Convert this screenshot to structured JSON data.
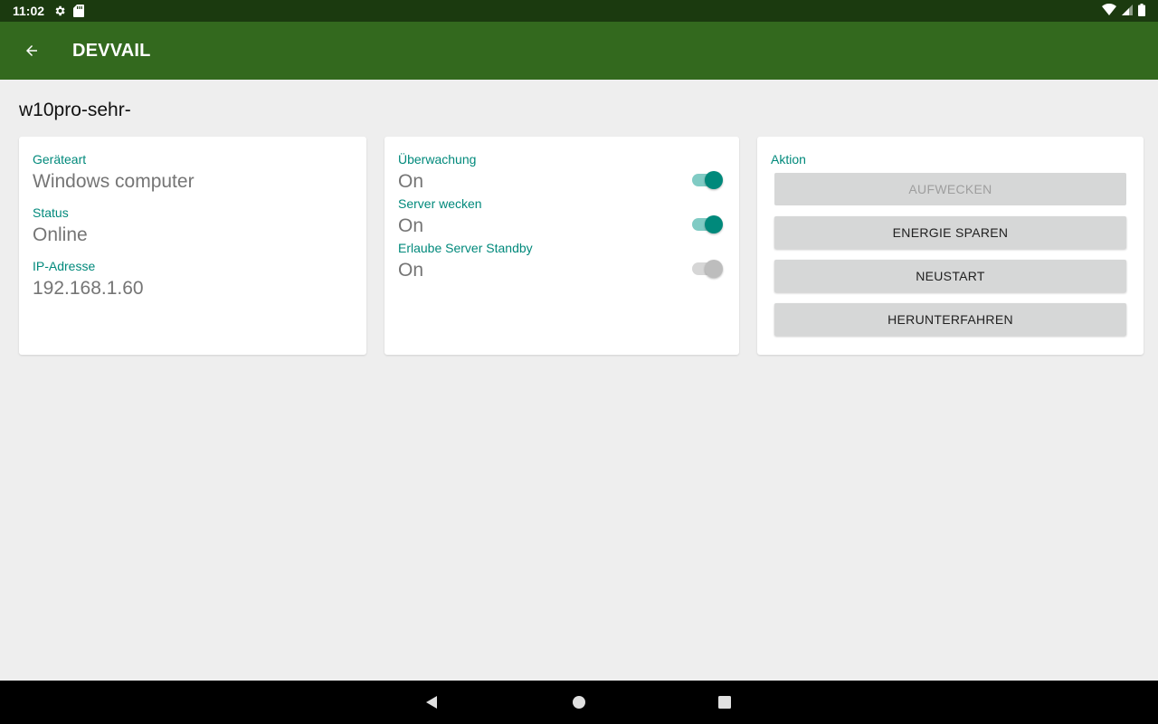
{
  "status_bar": {
    "time": "11:02",
    "icons": [
      "settings-icon",
      "sd-card-icon",
      "wifi-icon",
      "signal-icon",
      "battery-icon"
    ]
  },
  "app_bar": {
    "title": "DEVVAIL",
    "back_icon": "arrow-back-icon"
  },
  "device_name": "w10pro-sehr-",
  "info_card": {
    "device_type_label": "Geräteart",
    "device_type_value": "Windows computer",
    "status_label": "Status",
    "status_value": "Online",
    "ip_label": "IP-Adresse",
    "ip_value": "192.168.1.60"
  },
  "monitoring_card": {
    "items": [
      {
        "label": "Überwachung",
        "value": "On",
        "state": "on"
      },
      {
        "label": "Server wecken",
        "value": "On",
        "state": "on"
      },
      {
        "label": "Erlaube Server Standby",
        "value": "On",
        "state": "disabled"
      }
    ]
  },
  "action_card": {
    "label": "Aktion",
    "buttons": [
      {
        "label": "AUFWECKEN",
        "enabled": false
      },
      {
        "label": "ENERGIE SPAREN",
        "enabled": true
      },
      {
        "label": "NEUSTART",
        "enabled": true
      },
      {
        "label": "HERUNTERFAHREN",
        "enabled": true
      }
    ]
  },
  "nav_bar": {
    "icons": [
      "nav-back-icon",
      "nav-home-icon",
      "nav-recents-icon"
    ]
  },
  "colors": {
    "status_bar": "#1b3a0f",
    "app_bar": "#33691e",
    "accent": "#00897b",
    "background": "#eeeeee"
  }
}
